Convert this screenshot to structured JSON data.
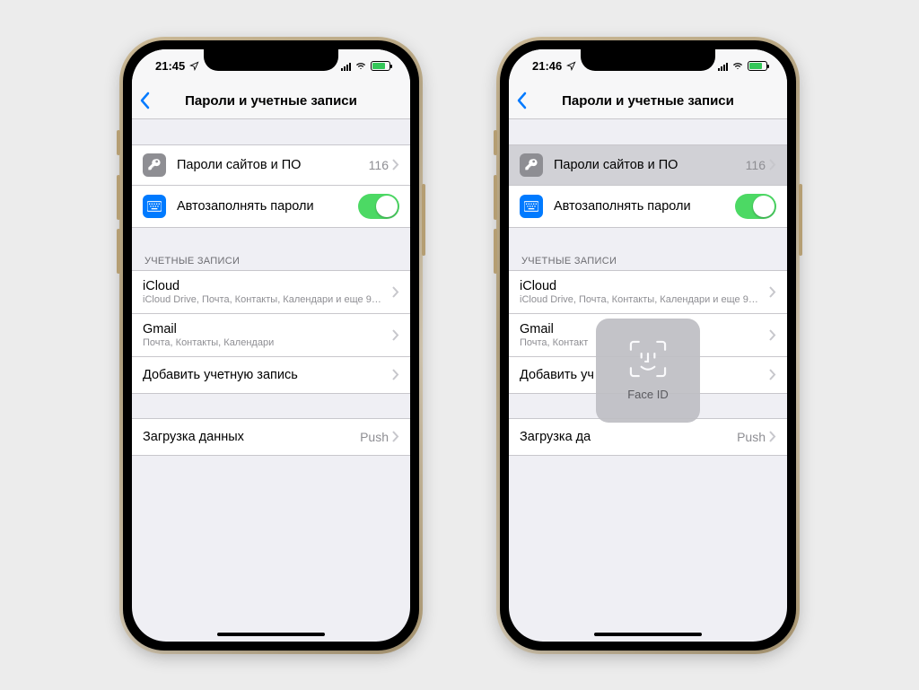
{
  "phones": [
    {
      "status": {
        "time": "21:45"
      },
      "nav_title": "Пароли и учетные записи",
      "passwords": {
        "label": "Пароли сайтов и ПО",
        "count": "116"
      },
      "autofill": {
        "label": "Автозаполнять пароли"
      },
      "accounts_header": "УЧЕТНЫЕ ЗАПИСИ",
      "accounts": [
        {
          "title": "iCloud",
          "detail": "iCloud Drive, Почта, Контакты, Календари и еще 9…"
        },
        {
          "title": "Gmail",
          "detail": "Почта, Контакты, Календари"
        }
      ],
      "add_account": "Добавить учетную запись",
      "fetch": {
        "label": "Загрузка данных",
        "value": "Push"
      },
      "highlight_passwords": false,
      "show_faceid": false
    },
    {
      "status": {
        "time": "21:46"
      },
      "nav_title": "Пароли и учетные записи",
      "passwords": {
        "label": "Пароли сайтов и ПО",
        "count": "116"
      },
      "autofill": {
        "label": "Автозаполнять пароли"
      },
      "accounts_header": "УЧЕТНЫЕ ЗАПИСИ",
      "accounts": [
        {
          "title": "iCloud",
          "detail": "iCloud Drive, Почта, Контакты, Календари и еще 9…"
        },
        {
          "title": "Gmail",
          "detail": "Почта, Контакт"
        }
      ],
      "add_account": "Добавить уч",
      "fetch": {
        "label": "Загрузка да",
        "value": "Push"
      },
      "highlight_passwords": true,
      "show_faceid": true,
      "faceid_label": "Face ID"
    }
  ]
}
